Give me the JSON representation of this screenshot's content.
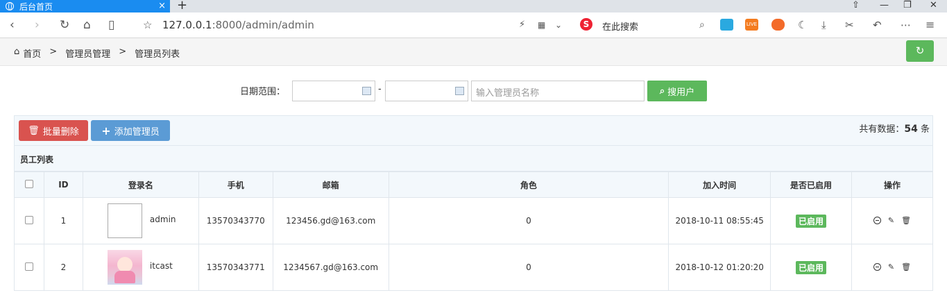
{
  "browser": {
    "tab_title": "后台首页",
    "url_host": "127.0.0.1",
    "url_rest": ":8000/admin/admin",
    "search_placeholder": "在此搜索"
  },
  "breadcrumb": {
    "home": "首页",
    "sep": ">",
    "level1": "管理员管理",
    "level2": "管理员列表"
  },
  "filter": {
    "date_label": "日期范围：",
    "date_sep": "-",
    "name_placeholder": "输入管理员名称",
    "search_button": "搜用户"
  },
  "actions": {
    "batch_delete": "批量删除",
    "add_admin": "添加管理员",
    "total_prefix": "共有数据：",
    "total_count": "54",
    "total_suffix": "条"
  },
  "table": {
    "caption": "员工列表",
    "headers": [
      "ID",
      "登录名",
      "手机",
      "邮箱",
      "角色",
      "加入时间",
      "是否已启用",
      "操作"
    ],
    "rows": [
      {
        "id": "1",
        "login": "admin",
        "phone": "13570343770",
        "email": "123456.gd@163.com",
        "role": "0",
        "joined": "2018-10-11 08:55:45",
        "status": "已启用"
      },
      {
        "id": "2",
        "login": "itcast",
        "phone": "13570343771",
        "email": "1234567.gd@163.com",
        "role": "0",
        "joined": "2018-10-12 01:20:20",
        "status": "已启用"
      }
    ]
  },
  "colors": {
    "primary_green": "#5cb85c",
    "danger_red": "#d9534f",
    "info_blue": "#5b9bd5",
    "tab_blue": "#1a8cf0"
  }
}
